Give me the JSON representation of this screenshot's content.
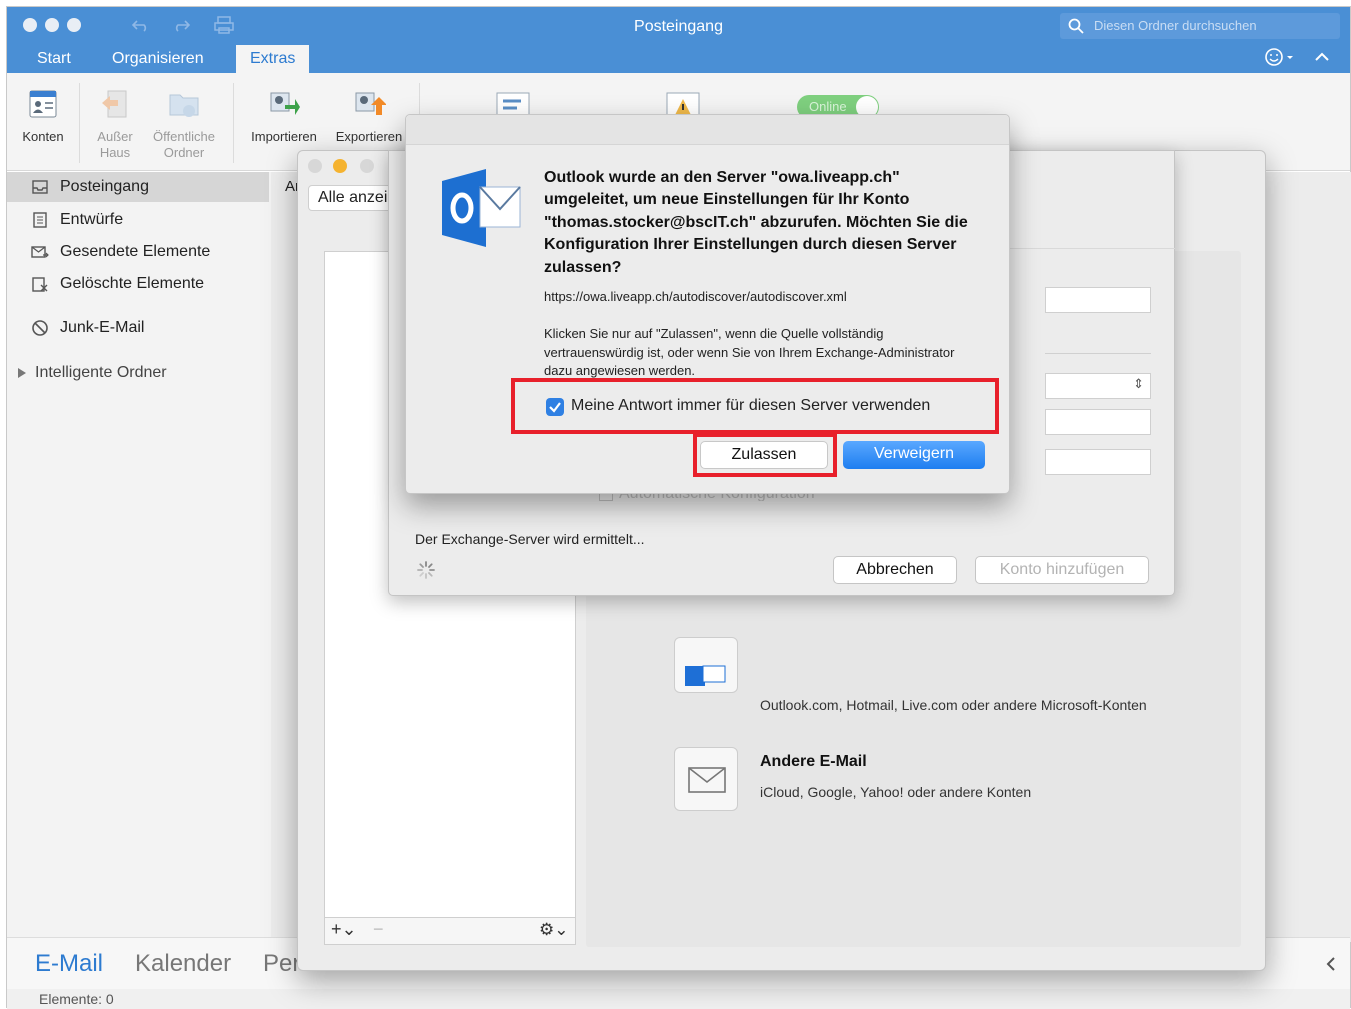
{
  "window": {
    "title": "Posteingang",
    "search_placeholder": "Diesen Ordner durchsuchen",
    "accent_color": "#4a8fd5"
  },
  "ribbon": {
    "tabs": [
      {
        "label": "Start"
      },
      {
        "label": "Organisieren"
      },
      {
        "label": "Extras",
        "active": true
      }
    ],
    "buttons": [
      {
        "label": "Konten",
        "icon": "accounts-icon"
      },
      {
        "label_line1": "Außer",
        "label_line2": "Haus",
        "icon": "out-of-office-icon",
        "disabled": true
      },
      {
        "label_line1": "Öffentliche",
        "label_line2": "Ordner",
        "icon": "public-folders-icon",
        "disabled": true
      },
      {
        "label": "Importieren",
        "icon": "import-icon"
      },
      {
        "label": "Exportieren",
        "icon": "export-icon"
      }
    ],
    "online_toggle_label": "Online"
  },
  "sidebar": {
    "items": [
      {
        "label": "Posteingang",
        "icon": "inbox-icon"
      },
      {
        "label": "Entwürfe",
        "icon": "drafts-icon"
      },
      {
        "label": "Gesendete Elemente",
        "icon": "sent-icon"
      },
      {
        "label": "Gelöschte Elemente",
        "icon": "trash-icon"
      },
      {
        "label": "Junk-E-Mail",
        "icon": "junk-icon"
      }
    ],
    "smart_folders_label": "Intelligente Ordner",
    "partial_header": "Ar"
  },
  "bottom_nav": {
    "items": [
      {
        "label": "E-Mail",
        "active": true
      },
      {
        "label": "Kalender"
      },
      {
        "label": "Per"
      }
    ]
  },
  "status_bar": {
    "text": "Elemente: 0"
  },
  "account_window": {
    "filter_label": "Alle anzeig",
    "providers": [
      {
        "description": "Outlook.com, Hotmail, Live.com oder andere Microsoft-Konten",
        "icon": "outlook-provider-icon"
      },
      {
        "title": "Andere E-Mail",
        "description": "iCloud, Google, Yahoo! oder andere Konten",
        "icon": "envelope-icon"
      }
    ]
  },
  "exchange_sheet": {
    "auto_config_label": "Automatische Konfiguration",
    "status_text": "Der Exchange-Server wird ermittelt...",
    "cancel_label": "Abbrechen",
    "add_account_label": "Konto hinzufügen"
  },
  "alert": {
    "heading": "Outlook wurde an den Server \"owa.liveapp.ch\" umgeleitet, um neue Einstellungen für Ihr Konto \"thomas.stocker@bscIT.ch\" abzurufen. Möchten Sie die Konfiguration Ihrer Einstellungen durch diesen Server zulassen?",
    "url": "https://owa.liveapp.ch/autodiscover/autodiscover.xml",
    "info": "Klicken Sie nur auf \"Zulassen\", wenn die Quelle vollständig vertrauenswürdig ist, oder wenn Sie von Ihrem Exchange-Administrator dazu angewiesen werden.",
    "checkbox_label": "Meine Antwort immer für diesen Server verwenden",
    "checkbox_checked": true,
    "allow_label": "Zulassen",
    "deny_label": "Verweigern",
    "highlight_color": "#e8202b"
  }
}
